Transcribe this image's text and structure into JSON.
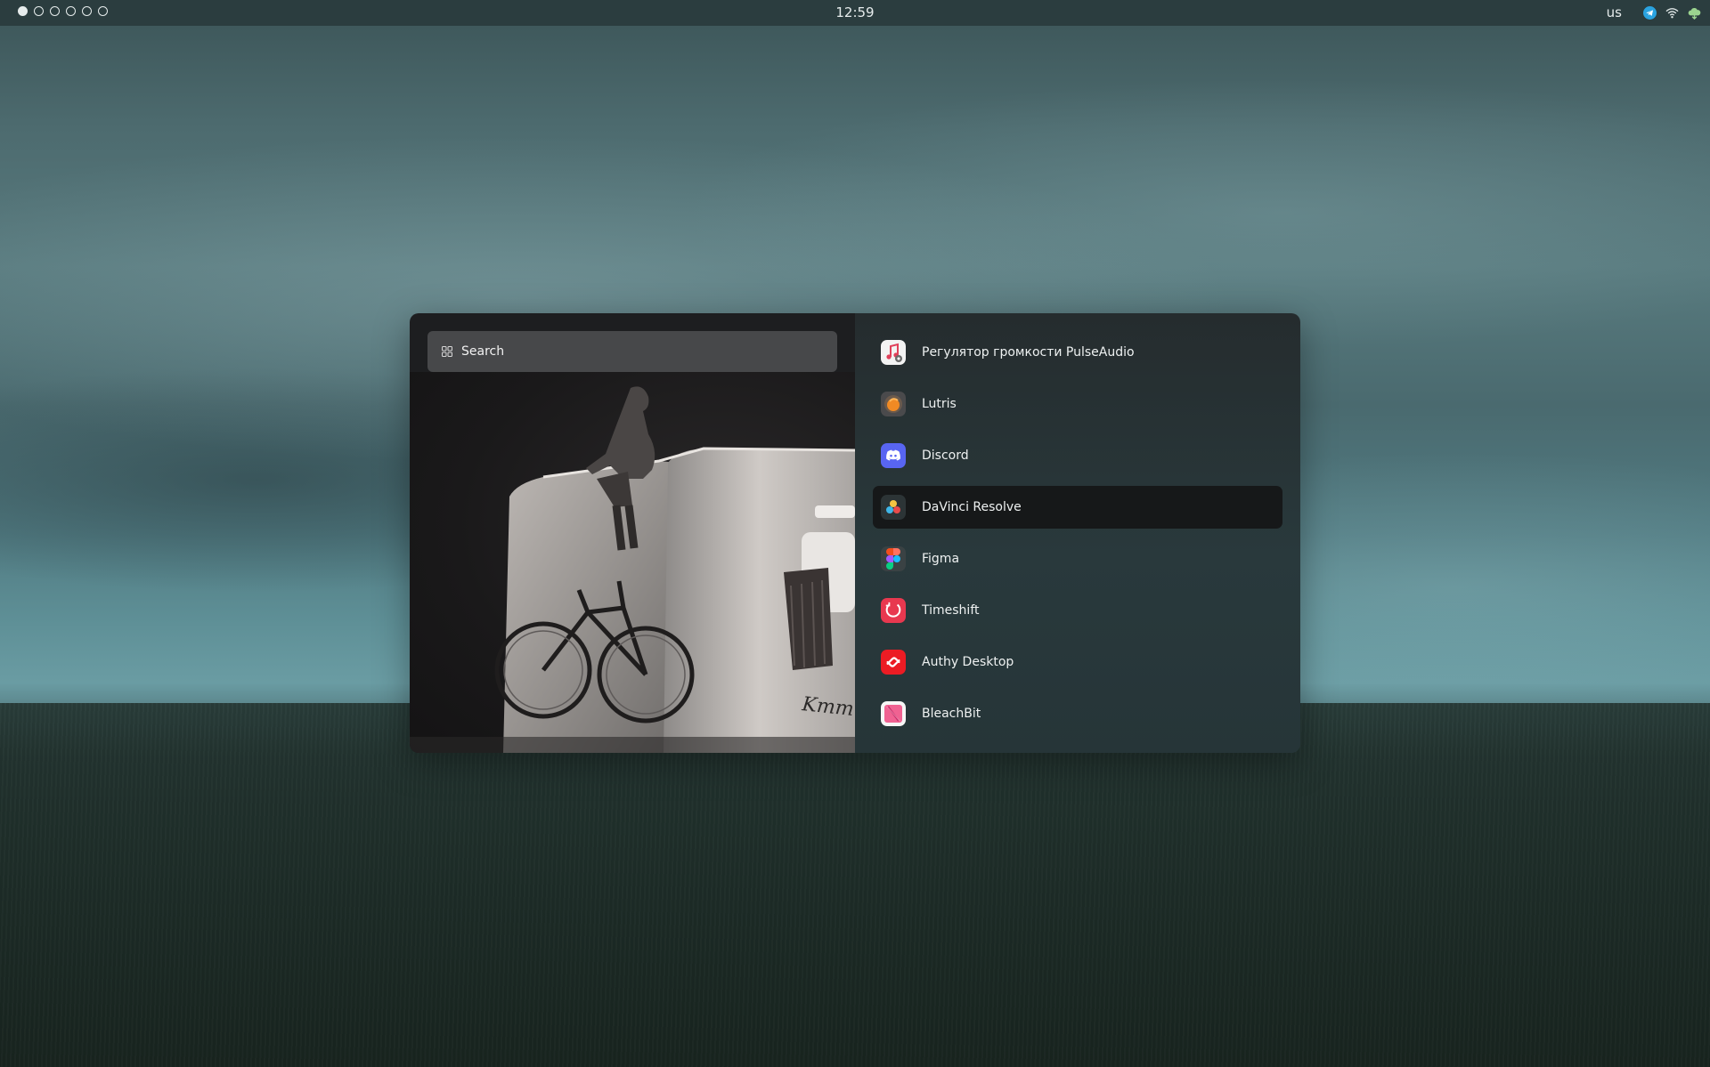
{
  "topbar": {
    "workspaces": [
      {
        "active": true
      },
      {
        "active": false
      },
      {
        "active": false
      },
      {
        "active": false
      },
      {
        "active": false
      },
      {
        "active": false
      }
    ],
    "clock": "12:59",
    "keyboard_layout": "us",
    "tray_icons": [
      "telegram-icon",
      "wifi-icon",
      "cloud-icon"
    ]
  },
  "launcher": {
    "search": {
      "placeholder": "Search",
      "icon": "grid-icon"
    },
    "apps": [
      {
        "label": "Регулятор громкости PulseAudio",
        "icon": "pulseaudio-icon",
        "selected": false
      },
      {
        "label": "Lutris",
        "icon": "lutris-icon",
        "selected": false
      },
      {
        "label": "Discord",
        "icon": "discord-icon",
        "selected": false
      },
      {
        "label": "DaVinci Resolve",
        "icon": "davinci-resolve-icon",
        "selected": true
      },
      {
        "label": "Figma",
        "icon": "figma-icon",
        "selected": false
      },
      {
        "label": "Timeshift",
        "icon": "timeshift-icon",
        "selected": false
      },
      {
        "label": "Authy Desktop",
        "icon": "authy-icon",
        "selected": false
      },
      {
        "label": "BleachBit",
        "icon": "bleachbit-icon",
        "selected": false
      }
    ]
  },
  "colors": {
    "topbar_bg": "#2b3d3f",
    "launcher_left_bg": "#1d1e20",
    "search_bg": "#47484a",
    "selected_item_bg": "#161819",
    "discord": "#5865f2",
    "authy": "#ec1c24",
    "timeshift": "#e8384f",
    "bleachbit": "#f06292"
  }
}
